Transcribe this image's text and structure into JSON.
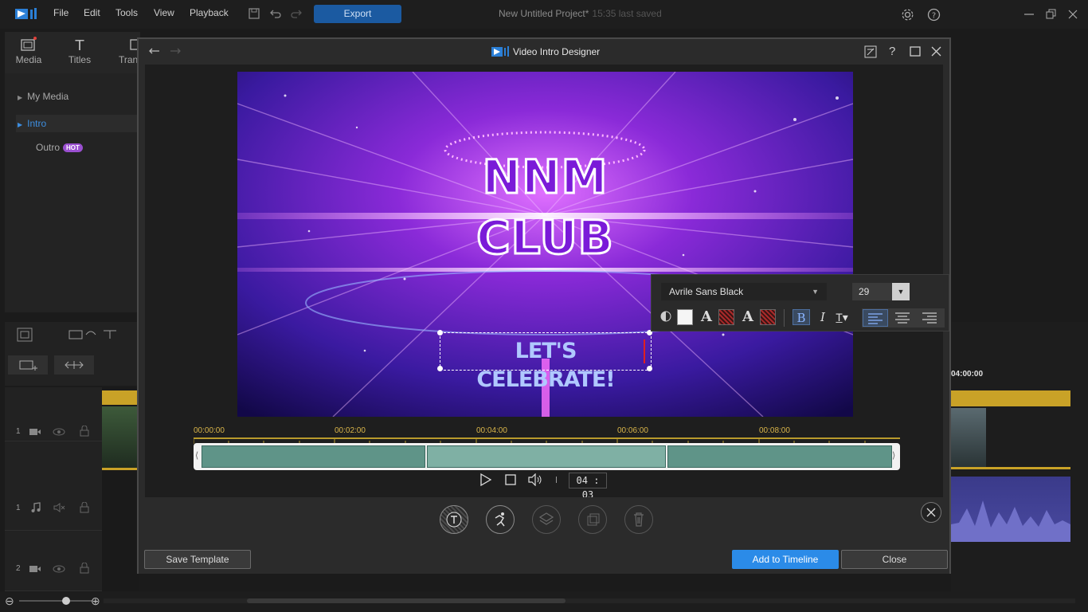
{
  "menu": {
    "file": "File",
    "edit": "Edit",
    "tools": "Tools",
    "view": "View",
    "playback": "Playback",
    "export": "Export"
  },
  "project": {
    "title": "New Untitled Project*",
    "saved": "15:35 last saved"
  },
  "rooms": [
    {
      "label": "Media"
    },
    {
      "label": "Titles"
    },
    {
      "label": "Trans"
    }
  ],
  "library": {
    "items": [
      {
        "label": "My Media"
      },
      {
        "label": "Intro"
      },
      {
        "label": "Outro"
      }
    ],
    "hot_badge": "HOT"
  },
  "tracks": [
    {
      "num": "1"
    },
    {
      "num": "1"
    },
    {
      "num": "2"
    }
  ],
  "right_timeline": {
    "timecode": "04:00:00"
  },
  "dialog": {
    "title": "Video Intro Designer",
    "save_template": "Save Template",
    "add_to_timeline": "Add to Timeline",
    "close": "Close"
  },
  "preview": {
    "line1": "NNM",
    "line2": "CLUB",
    "subtitle": "LET'S CELEBRATE!"
  },
  "text_toolbar": {
    "font": "Avrile Sans Black",
    "size": "29"
  },
  "ruler": {
    "ticks": [
      "00:00:00",
      "00:02:00",
      "00:04:00",
      "00:06:00",
      "00:08:00"
    ]
  },
  "player": {
    "time": "04 : 03"
  },
  "colors": {
    "accent": "#2b8be8",
    "export": "#1b5aa1",
    "clip": "#5f9488",
    "ruler": "#d9b54a"
  }
}
